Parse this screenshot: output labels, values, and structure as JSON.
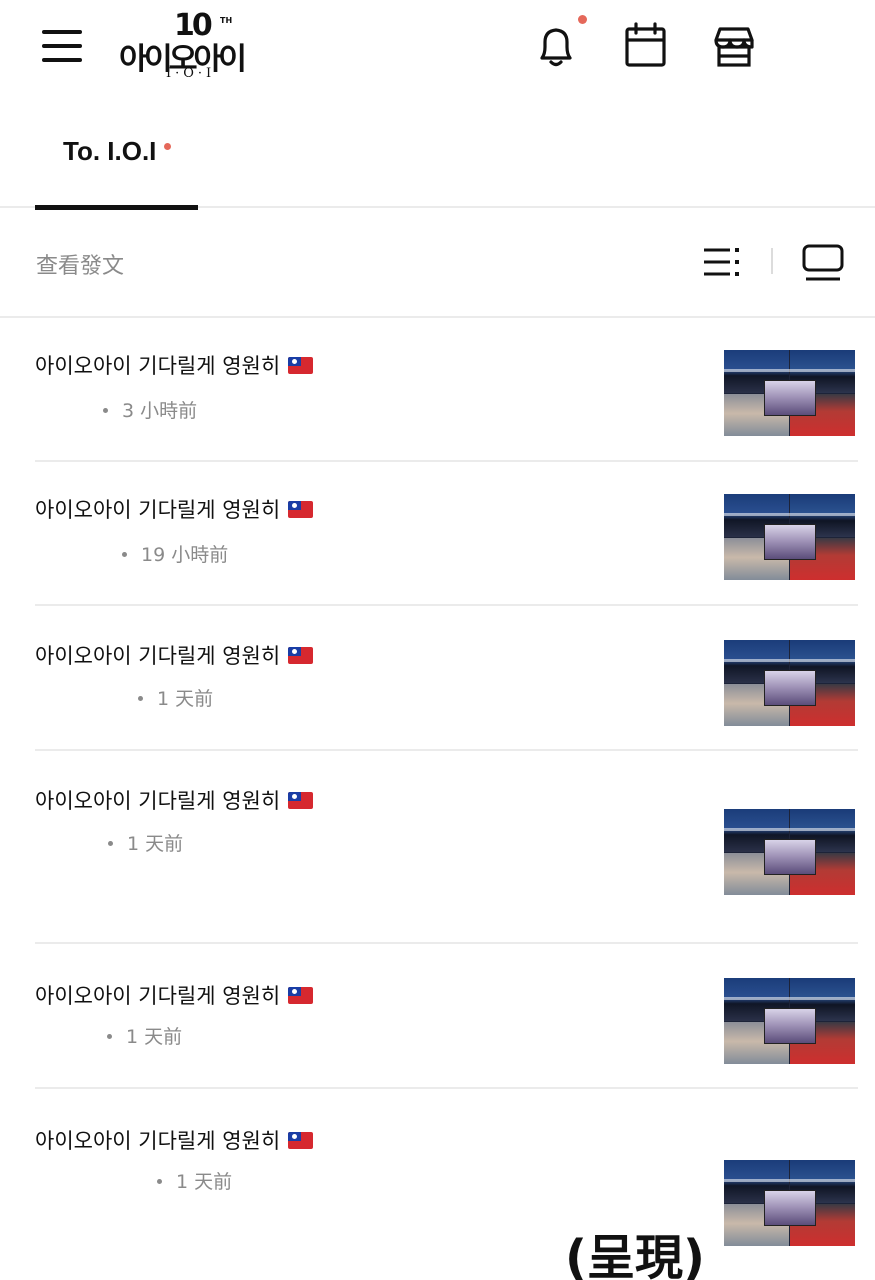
{
  "header": {
    "logo": {
      "anniversary": "10",
      "anniversary_suffix": "TH",
      "wordmark": "아이오아이",
      "subtitle": "I·O·I"
    },
    "icons": [
      "menu-icon",
      "bell-icon",
      "calendar-icon",
      "store-icon"
    ],
    "notification_dot_color": "#e5685a"
  },
  "tabs": [
    {
      "label": "To. I.O.I",
      "active": true,
      "has_new_dot": true
    }
  ],
  "toolbar": {
    "label": "查看發文",
    "view_icons": [
      "list-view-icon",
      "card-view-icon"
    ]
  },
  "posts": [
    {
      "title": "아이오아이 기다릴게 영원히",
      "time": "3 小時前",
      "flag": "taiwan-flag"
    },
    {
      "title": "아이오아이 기다릴게 영원히",
      "time": "19 小時前",
      "flag": "taiwan-flag"
    },
    {
      "title": "아이오아이 기다릴게 영원히",
      "time": "1 天前",
      "flag": "taiwan-flag"
    },
    {
      "title": "아이오아이 기다릴게 영원히",
      "time": "1 天前",
      "flag": "taiwan-flag"
    },
    {
      "title": "아이오아이 기다릴게 영원히",
      "time": "1 天前",
      "flag": "taiwan-flag"
    },
    {
      "title": "아이오아이 기다릴게 영원히",
      "time": "1 天前",
      "flag": "taiwan-flag"
    }
  ],
  "watermark": "(呈現)",
  "colors": {
    "accent_dot": "#e5685a",
    "text_primary": "#111111",
    "text_secondary": "#8a8a8a",
    "divider": "#ebebeb"
  }
}
